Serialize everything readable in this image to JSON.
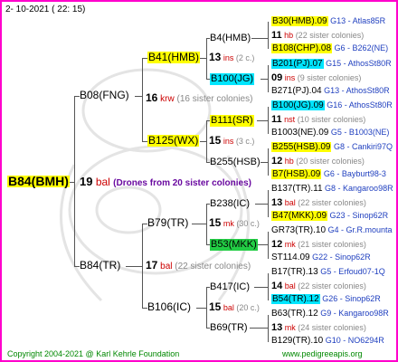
{
  "top_date": "2- 10-2021 (  22:  15)",
  "root": {
    "name": "B84(BMH)",
    "sisters": "19",
    "sister_unit": "bal",
    "sister_note": "(Drones from 20 sister colonies)"
  },
  "father": {
    "name": "B08(FNG)",
    "sisters": "16",
    "unit": "krw",
    "note": "(16 sister colonies)"
  },
  "mother": {
    "name": "B84(TR)",
    "sisters": "17",
    "unit": "bal",
    "note": "(22 sister colonies)"
  },
  "ff": {
    "name": "B41(HMB)",
    "sisters": "13",
    "unit": "ins",
    "note": "(2 c.)"
  },
  "fm": {
    "name": "B125(WX)",
    "sisters": "15",
    "unit": "ins",
    "note": "(3 c.)"
  },
  "mf": {
    "name": "B79(TR)",
    "sisters": "15",
    "unit": "mk",
    "note": "(30 c.)"
  },
  "mm": {
    "name": "B106(IC)",
    "sisters": "15",
    "unit": "bal",
    "note": "(20 c.)"
  },
  "l3": [
    {
      "name": "B4(HMB)",
      "sisters": "",
      "unit": "",
      "note": ""
    },
    {
      "name": "B100(JG)",
      "sisters": "",
      "unit": "",
      "note": ""
    },
    {
      "name": "B111(SR)",
      "sisters": "11",
      "unit": "nst",
      "note": "(10 sister colonies)"
    },
    {
      "name": "B255(HSB)",
      "sisters": "",
      "unit": "",
      "note": ""
    },
    {
      "name": "B238(IC)",
      "sisters": "",
      "unit": "",
      "note": ""
    },
    {
      "name": "B53(MKK)",
      "sisters": "",
      "unit": "",
      "note": ""
    },
    {
      "name": "B417(IC)",
      "sisters": "",
      "unit": "",
      "note": ""
    },
    {
      "name": "B69(TR)",
      "sisters": "",
      "unit": "",
      "note": ""
    }
  ],
  "l4": [
    {
      "a": "B30(HMB).09",
      "b": "G13 - Atlas85R",
      "style": "hl"
    },
    {
      "a": "11",
      "u": "hb",
      "c": "(22 sister colonies)"
    },
    {
      "a": "B108(CHP).08",
      "b": "G6 - B262(NE)",
      "style": "hl"
    },
    {
      "a": "B201(PJ).07",
      "b": "G15 - AthosSt80R",
      "style": "hlc"
    },
    {
      "a": "09",
      "u": "ins",
      "c": "(9 sister colonies)"
    },
    {
      "a": "B271(PJ).04",
      "b": "G13 - AthosSt80R",
      "style": ""
    },
    {
      "a": "B100(JG).09",
      "b": "G16 - AthosSt80R",
      "style": "hlc"
    },
    {
      "a": "11",
      "u": "nst",
      "c": "(10 sister colonies)"
    },
    {
      "a": "B1003(NE).09",
      "b": "G5 - B1003(NE)",
      "style": ""
    },
    {
      "a": "B255(HSB).09",
      "b": "G8 - Cankiri97Q",
      "style": "hl"
    },
    {
      "a": "12",
      "u": "hb",
      "c": "(20 sister colonies)"
    },
    {
      "a": "B7(HSB).09",
      "b": "G6 - Bayburt98-3",
      "style": "hl"
    },
    {
      "a": "B137(TR).11",
      "b": "G8 - Kangaroo98R",
      "style": ""
    },
    {
      "a": "13",
      "u": "bal",
      "c": "(22 sister colonies)"
    },
    {
      "a": "B47(MKK).09",
      "b": "G23 - Sinop62R",
      "style": "hl"
    },
    {
      "a": "GR73(TR).10",
      "b": "G4 - Gr.R.mounta",
      "style": ""
    },
    {
      "a": "12",
      "u": "mk",
      "c": "(21 sister colonies)"
    },
    {
      "a": "ST114.09",
      "b": "G22 - Sinop62R",
      "style": ""
    },
    {
      "a": "B17(TR).13",
      "b": "G5 - Erfoud07-1Q",
      "style": ""
    },
    {
      "a": "14",
      "u": "bal",
      "c": "(22 sister colonies)"
    },
    {
      "a": "B54(TR).12",
      "b": "G26 - Sinop62R",
      "style": "hlc"
    },
    {
      "a": "B63(TR).12",
      "b": "G9 - Kangaroo98R",
      "style": ""
    },
    {
      "a": "13",
      "u": "mk",
      "c": "(24 sister colonies)"
    },
    {
      "a": "B129(TR).10",
      "b": "G10 - NO6294R",
      "style": ""
    }
  ],
  "footer_left": "Copyright 2004-2021 @ Karl Kehrle Foundation",
  "footer_right": "www.pedigreeapis.org",
  "colors": {
    "border": "#ff00cc",
    "highlight_yellow": "#ffff00",
    "highlight_cyan": "#00e5ff",
    "highlight_green": "#22cc44",
    "sister_unit": "#cc0000",
    "generation_text": "#1f3fbf"
  }
}
